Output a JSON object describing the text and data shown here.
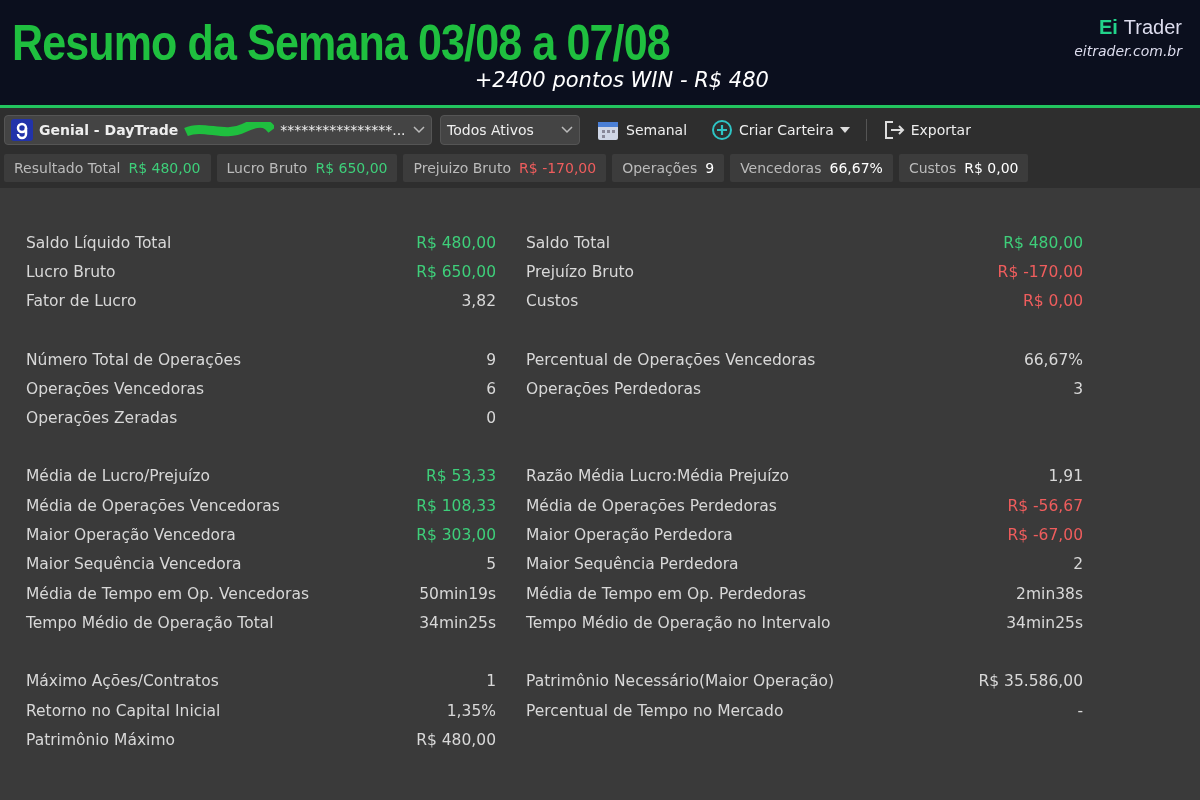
{
  "banner": {
    "title": "Resumo da Semana 03/08 a 07/08",
    "subtitle": "+2400 pontos WIN - R$ 480",
    "brand": {
      "accent": "Ei",
      "name": "Trader",
      "site": "eitrader.com.br"
    }
  },
  "toolbar": {
    "account": {
      "name": "Genial - DayTrade",
      "masked": "****************..."
    },
    "assets": "Todos Ativos",
    "period": "Semanal",
    "create": "Criar Carteira",
    "export": "Exportar"
  },
  "chips": [
    {
      "label": "Resultado Total",
      "value": "R$ 480,00",
      "color": "#3ecf7a"
    },
    {
      "label": "Lucro Bruto",
      "value": "R$ 650,00",
      "color": "#3ecf7a"
    },
    {
      "label": "Prejuizo Bruto",
      "value": "R$ -170,00",
      "color": "#ef5d5d"
    },
    {
      "label": "Operações",
      "value": "9",
      "color": "#ffffff"
    },
    {
      "label": "Vencedoras",
      "value": "66,67%",
      "color": "#ffffff"
    },
    {
      "label": "Custos",
      "value": "R$ 0,00",
      "color": "#ffffff"
    }
  ],
  "groups": [
    {
      "rows": [
        {
          "left": {
            "label": "Saldo Líquido Total",
            "value": "R$ 480,00",
            "color": "#3ecf7a"
          },
          "right": {
            "label": "Saldo Total",
            "value": "R$ 480,00",
            "color": "#3ecf7a"
          }
        },
        {
          "left": {
            "label": "Lucro Bruto",
            "value": "R$ 650,00",
            "color": "#3ecf7a"
          },
          "right": {
            "label": "Prejuízo Bruto",
            "value": "R$ -170,00",
            "color": "#ef5d5d"
          }
        },
        {
          "left": {
            "label": "Fator de Lucro",
            "value": "3,82",
            "color": "#d8d8d8"
          },
          "right": {
            "label": "Custos",
            "value": "R$ 0,00",
            "color": "#ef5d5d"
          }
        }
      ]
    },
    {
      "rows": [
        {
          "left": {
            "label": "Número Total de Operações",
            "value": "9",
            "color": "#d8d8d8"
          },
          "right": {
            "label": "Percentual de Operações Vencedoras",
            "value": "66,67%",
            "color": "#d8d8d8"
          }
        },
        {
          "left": {
            "label": "Operações Vencedoras",
            "value": "6",
            "color": "#d8d8d8"
          },
          "right": {
            "label": "Operações Perdedoras",
            "value": "3",
            "color": "#d8d8d8"
          }
        },
        {
          "left": {
            "label": "Operações Zeradas",
            "value": "0",
            "color": "#d8d8d8"
          }
        }
      ]
    },
    {
      "rows": [
        {
          "left": {
            "label": "Média de Lucro/Prejuízo",
            "value": "R$ 53,33",
            "color": "#3ecf7a"
          },
          "right": {
            "label": "Razão Média Lucro:Média Prejuízo",
            "value": "1,91",
            "color": "#d8d8d8"
          }
        },
        {
          "left": {
            "label": "Média de Operações Vencedoras",
            "value": "R$ 108,33",
            "color": "#3ecf7a"
          },
          "right": {
            "label": "Média de Operações Perdedoras",
            "value": "R$ -56,67",
            "color": "#ef5d5d"
          }
        },
        {
          "left": {
            "label": "Maior Operação Vencedora",
            "value": "R$ 303,00",
            "color": "#3ecf7a"
          },
          "right": {
            "label": "Maior Operação Perdedora",
            "value": "R$ -67,00",
            "color": "#ef5d5d"
          }
        },
        {
          "left": {
            "label": "Maior Sequência Vencedora",
            "value": "5",
            "color": "#d8d8d8"
          },
          "right": {
            "label": "Maior Sequência Perdedora",
            "value": "2",
            "color": "#d8d8d8"
          }
        },
        {
          "left": {
            "label": "Média de Tempo em Op. Vencedoras",
            "value": "50min19s",
            "color": "#d8d8d8"
          },
          "right": {
            "label": "Média de Tempo em Op. Perdedoras",
            "value": "2min38s",
            "color": "#d8d8d8"
          }
        },
        {
          "left": {
            "label": "Tempo Médio de Operação Total",
            "value": "34min25s",
            "color": "#d8d8d8"
          },
          "right": {
            "label": "Tempo Médio de Operação no Intervalo",
            "value": "34min25s",
            "color": "#d8d8d8"
          }
        }
      ]
    },
    {
      "rows": [
        {
          "left": {
            "label": "Máximo Ações/Contratos",
            "value": "1",
            "color": "#d8d8d8"
          },
          "right": {
            "label": "Patrimônio Necessário(Maior Operação)",
            "value": "R$ 35.586,00",
            "color": "#d8d8d8"
          }
        },
        {
          "left": {
            "label": "Retorno no Capital Inicial",
            "value": "1,35%",
            "color": "#d8d8d8"
          },
          "right": {
            "label": "Percentual de Tempo no Mercado",
            "value": "-",
            "color": "#d8d8d8"
          }
        },
        {
          "left": {
            "label": "Patrimônio Máximo",
            "value": "R$ 480,00",
            "color": "#d8d8d8"
          }
        }
      ]
    }
  ]
}
